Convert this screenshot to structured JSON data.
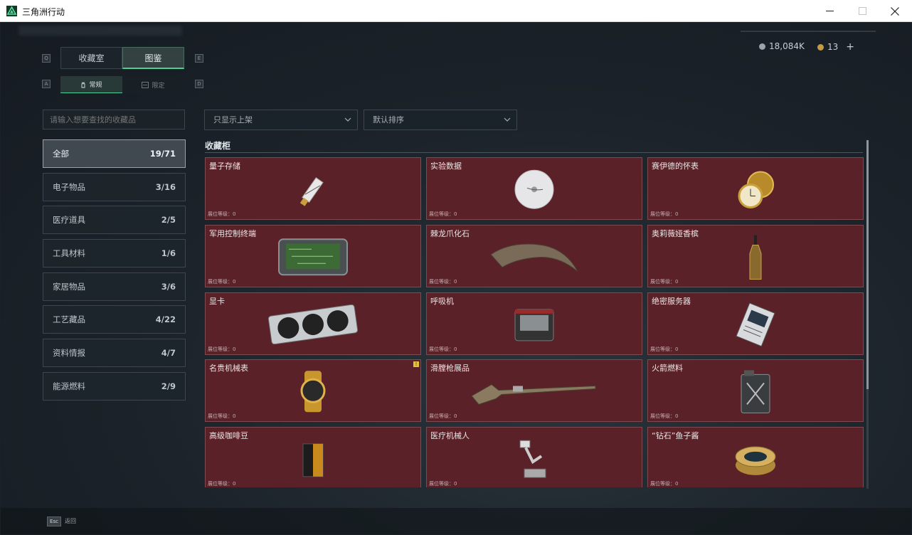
{
  "window": {
    "title": "三角洲行动"
  },
  "currency": {
    "coins": "18,084K",
    "tokens": "13",
    "add_label": "+"
  },
  "key_hints": {
    "left_top": "Q",
    "right_top": "E",
    "left_sub": "A",
    "right_sub": "D"
  },
  "tabs": [
    {
      "label": "收藏室"
    },
    {
      "label": "图鉴"
    }
  ],
  "sub_tabs": [
    {
      "label": "常规"
    },
    {
      "label": "限定"
    }
  ],
  "search": {
    "placeholder": "请输入想要查找的收藏品"
  },
  "categories": [
    {
      "label": "全部",
      "count": "19/71"
    },
    {
      "label": "电子物品",
      "count": "3/16"
    },
    {
      "label": "医疗道具",
      "count": "2/5"
    },
    {
      "label": "工具材料",
      "count": "1/6"
    },
    {
      "label": "家居物品",
      "count": "3/6"
    },
    {
      "label": "工艺藏品",
      "count": "4/22"
    },
    {
      "label": "资料情报",
      "count": "4/7"
    },
    {
      "label": "能源燃料",
      "count": "2/9"
    }
  ],
  "filters": {
    "display": "只显示上架",
    "sort": "默认排序"
  },
  "section": {
    "title": "收藏柜"
  },
  "level_label": "展位等级：0",
  "items": [
    {
      "name": "量子存储",
      "icon": "usb-drive"
    },
    {
      "name": "实验数据",
      "icon": "disc"
    },
    {
      "name": "赛伊德的怀表",
      "icon": "pocket-watch"
    },
    {
      "name": "军用控制终端",
      "icon": "control-terminal"
    },
    {
      "name": "棘龙爪化石",
      "icon": "claw-fossil"
    },
    {
      "name": "奥莉薇娅香槟",
      "icon": "champagne-bottle"
    },
    {
      "name": "显卡",
      "icon": "graphics-card"
    },
    {
      "name": "呼吸机",
      "icon": "ventilator"
    },
    {
      "name": "绝密服务器",
      "icon": "server"
    },
    {
      "name": "名贵机械表",
      "icon": "wristwatch",
      "badge": "!"
    },
    {
      "name": "滑膛枪展品",
      "icon": "musket"
    },
    {
      "name": "火箭燃料",
      "icon": "fuel-can"
    },
    {
      "name": "高级咖啡豆",
      "icon": "coffee-bag"
    },
    {
      "name": "医疗机械人",
      "icon": "medical-robot"
    },
    {
      "name": "“钻石”鱼子酱",
      "icon": "caviar-tin"
    }
  ],
  "footer": {
    "esc_key": "Esc",
    "back_label": "返回"
  }
}
